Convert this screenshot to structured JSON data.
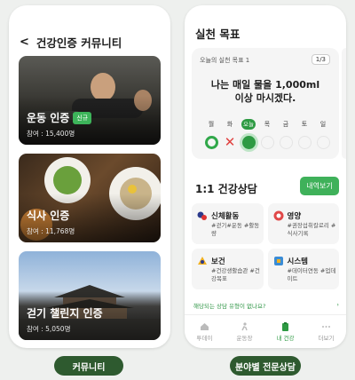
{
  "left": {
    "title": "건강인증 커뮤니티",
    "cards": [
      {
        "title": "운동 인증",
        "badge": "신규",
        "sub": "참여 : 15,400명"
      },
      {
        "title": "식사 인증",
        "badge": "",
        "sub": "참여 : 11,768명"
      },
      {
        "title": "걷기 챌린지 인증",
        "badge": "",
        "sub": "참여 : 5,050명"
      }
    ]
  },
  "right": {
    "title": "실천 목표",
    "goal_label": "오늘의 실천 목표 1",
    "goal_page": "1/3",
    "goal_text_line1": "나는 매일 물을 1,000ml",
    "goal_text_line2": "이상 마시겠다.",
    "days": [
      "월",
      "화",
      "오늘",
      "목",
      "금",
      "토",
      "일"
    ],
    "consult_title": "1:1 건강상담",
    "history_button": "내역보기",
    "categories": [
      {
        "name": "신체활동",
        "tags": "#걷기#운동 #활동량"
      },
      {
        "name": "영양",
        "tags": "#권장섭취칼로리 #식사기록"
      },
      {
        "name": "보건",
        "tags": "#건강생활습관 #건강목표"
      },
      {
        "name": "시스템",
        "tags": "#데이터연동 #업데이트"
      }
    ],
    "faq": "해당되는 상담 유형이 없나요?",
    "faq_arrow": "›",
    "tabs": [
      "투데이",
      "운동장",
      "내 건강",
      "더보기"
    ]
  },
  "pills": {
    "left": "커뮤니티",
    "right": "분야별 전문상담"
  }
}
